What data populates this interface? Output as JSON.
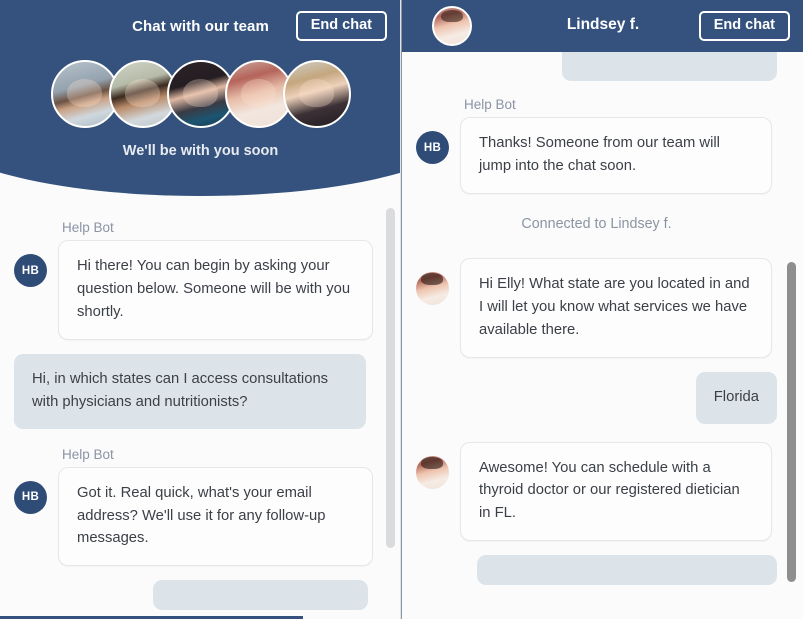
{
  "left_panel": {
    "header": {
      "title": "Chat with our team",
      "end_chat_label": "End chat",
      "waiting_note": "We'll be with you soon",
      "background_color": "#34527d",
      "avatars": [
        {
          "name": "team-member-1"
        },
        {
          "name": "team-member-2"
        },
        {
          "name": "team-member-3"
        },
        {
          "name": "team-member-4"
        },
        {
          "name": "team-member-5"
        }
      ]
    },
    "messages": [
      {
        "role": "bot",
        "sender": "Help Bot",
        "avatar_initials": "HB",
        "text": "Hi there! You can begin by asking your question below. Someone will be with you shortly."
      },
      {
        "role": "user",
        "text": "Hi, in which states can I access consultations with physicians and nutritionists?"
      },
      {
        "role": "bot",
        "sender": "Help Bot",
        "avatar_initials": "HB",
        "text": "Got it. Real quick, what's your email address? We'll use it for any follow-up messages."
      },
      {
        "role": "user",
        "text": ""
      }
    ]
  },
  "right_panel": {
    "header": {
      "title": "Lindsey f.",
      "end_chat_label": "End chat",
      "background_color": "#34527d",
      "agent_avatar": "lindsey-avatar"
    },
    "messages": [
      {
        "role": "user",
        "text": ""
      },
      {
        "role": "bot",
        "sender": "Help Bot",
        "avatar_initials": "HB",
        "text": "Thanks! Someone from our team will jump into the chat soon."
      },
      {
        "role": "system",
        "text": "Connected to Lindsey f."
      },
      {
        "role": "agent",
        "text": "Hi Elly! What state are you located in and I will let you know what services we have available there."
      },
      {
        "role": "user",
        "text": "Florida"
      },
      {
        "role": "agent",
        "text": "Awesome! You can schedule with a thyroid doctor or our registered dietician in FL."
      },
      {
        "role": "user",
        "text": ""
      }
    ]
  }
}
